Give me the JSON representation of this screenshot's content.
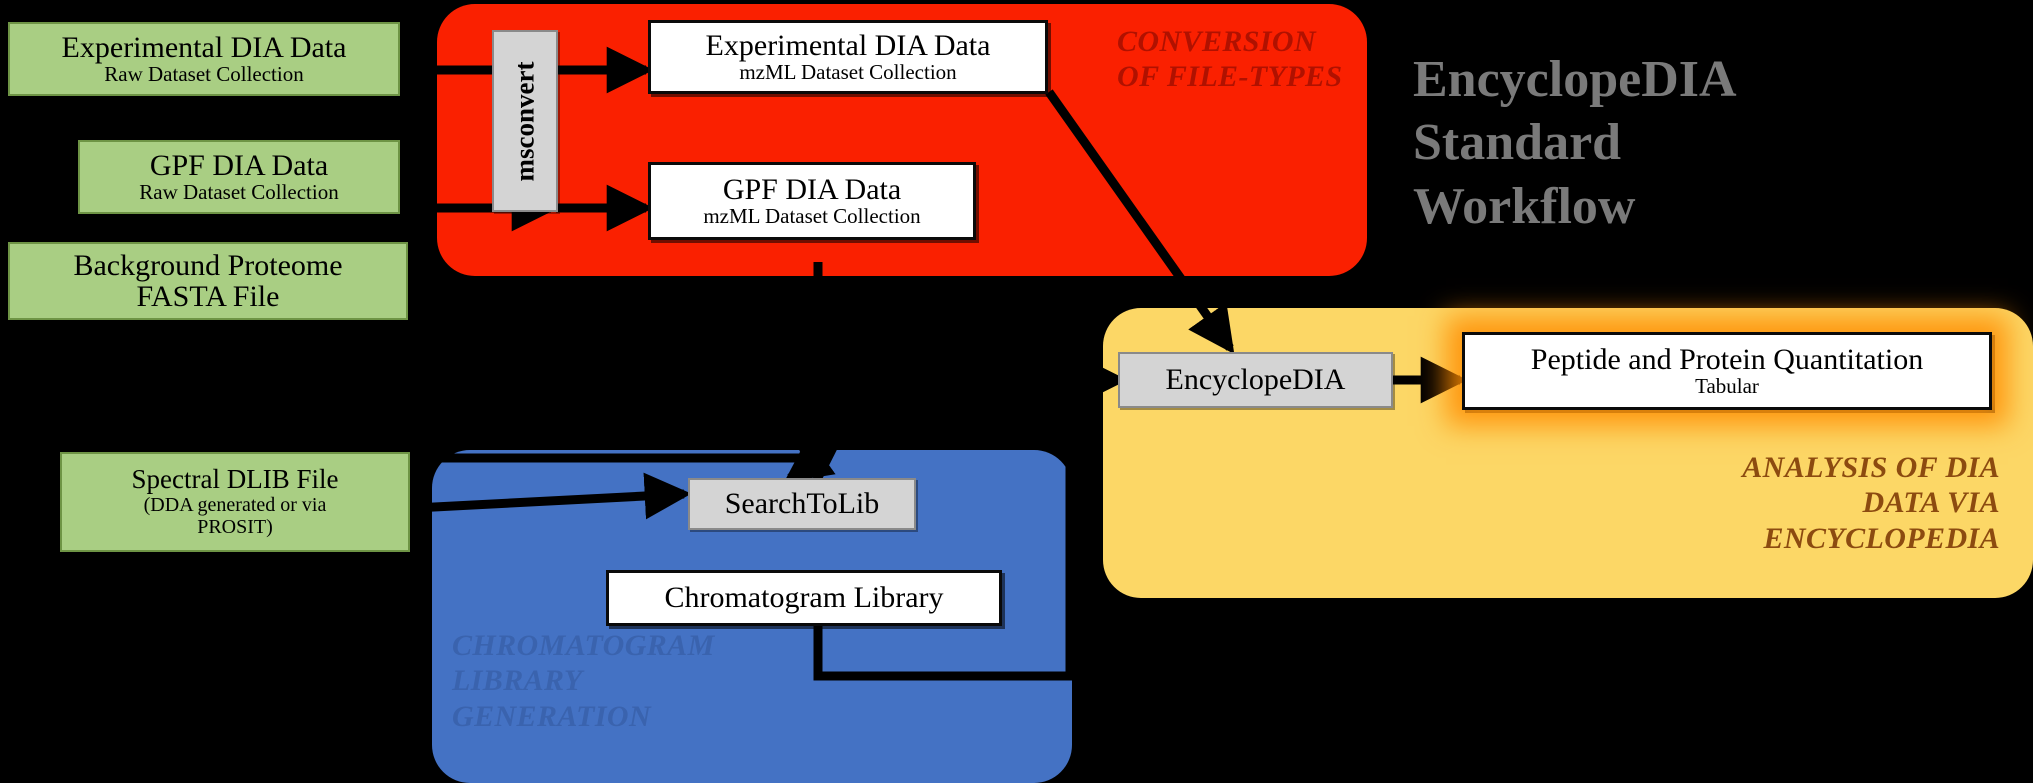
{
  "title": {
    "lines": [
      "EncyclopeDIA",
      "Standard",
      "Workflow"
    ],
    "color": "#7A7A7A"
  },
  "panels": [
    {
      "id": "conversion",
      "label_lines": [
        "CONVERSION",
        "OF FILE-TYPES"
      ],
      "color": "#FA2000",
      "label_color": "#B01100"
    },
    {
      "id": "library",
      "label_lines": [
        "CHROMATOGRAM",
        "LIBRARY",
        "GENERATION"
      ],
      "color": "#4472C4",
      "label_color": "#3A63AE"
    },
    {
      "id": "analysis",
      "label_lines": [
        "ANALYSIS OF DIA",
        "DATA VIA",
        "ENCYCLOPEDIA"
      ],
      "color": "#FCD766",
      "label_color": "#8C4B10"
    }
  ],
  "inputs": [
    {
      "id": "exp-raw",
      "title": "Experimental DIA Data",
      "subtitle": "Raw Dataset Collection"
    },
    {
      "id": "gpf-raw",
      "title": "GPF DIA Data",
      "subtitle": "Raw Dataset Collection"
    },
    {
      "id": "fasta",
      "title_line1": "Background Proteome",
      "title_line2": "FASTA File"
    },
    {
      "id": "dlib",
      "title": "Spectral DLIB File",
      "subtitle_line1": "(DDA generated or via",
      "subtitle_line2": "PROSIT)"
    }
  ],
  "tools": [
    {
      "id": "msconvert",
      "label": "msconvert"
    },
    {
      "id": "searchtolib",
      "label": "SearchToLib"
    },
    {
      "id": "encyclopedia",
      "label": "EncyclopeDIA"
    }
  ],
  "outputs": [
    {
      "id": "exp-mzml",
      "title": "Experimental DIA Data",
      "subtitle": "mzML Dataset Collection"
    },
    {
      "id": "gpf-mzml",
      "title": "GPF DIA Data",
      "subtitle": "mzML Dataset Collection"
    },
    {
      "id": "chrom-lib",
      "title": "Chromatogram Library"
    },
    {
      "id": "quant",
      "title": "Peptide and Protein Quantitation",
      "subtitle": "Tabular"
    }
  ],
  "colors": {
    "green_fill": "#A9CE83",
    "white_fill": "#FFFFFF",
    "gray_fill": "#D4D4D4",
    "background": "#000000",
    "arrow": "#000000",
    "glow": "#FF8C00"
  }
}
